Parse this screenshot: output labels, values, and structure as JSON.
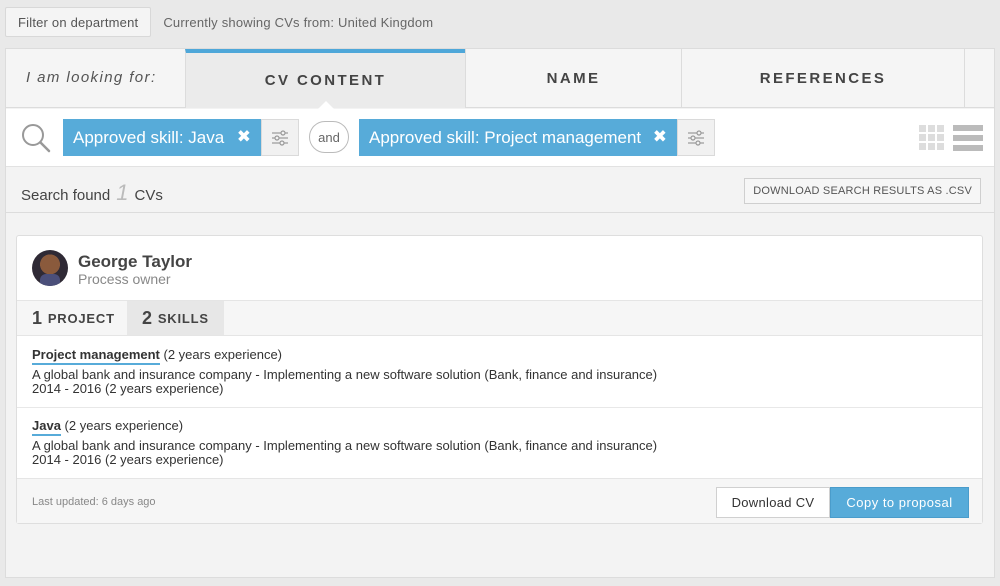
{
  "topbar": {
    "filter_label": "Filter on department",
    "showing_text": "Currently showing CVs from: United Kingdom"
  },
  "tabs": {
    "looking_label": "I am looking for:",
    "items": [
      {
        "label": "CV CONTENT",
        "active": true
      },
      {
        "label": "NAME",
        "active": false
      },
      {
        "label": "REFERENCES",
        "active": false
      }
    ]
  },
  "search": {
    "chips": [
      {
        "label": "Approved skill: Java",
        "remove": "✖"
      },
      {
        "label": "Approved skill: Project management",
        "remove": "✖"
      }
    ],
    "operator": "and"
  },
  "results": {
    "prefix": "Search found",
    "count": "1",
    "suffix": "CVs",
    "download_csv_label": "DOWNLOAD SEARCH RESULTS AS .CSV"
  },
  "cv": {
    "name": "George Taylor",
    "role": "Process owner",
    "tabs": [
      {
        "count": "1",
        "label": "PROJECT"
      },
      {
        "count": "2",
        "label": "SKILLS"
      }
    ],
    "skills": [
      {
        "skill": "Project management",
        "experience": "(2 years experience)",
        "detail": "A global bank and insurance company - Implementing a new software solution (Bank, finance and insurance)",
        "period": "2014 - 2016 (2 years experience)"
      },
      {
        "skill": "Java",
        "experience": "(2 years experience)",
        "detail": "A global bank and insurance company - Implementing a new software solution (Bank, finance and insurance)",
        "period": "2014 - 2016 (2 years experience)"
      }
    ],
    "last_updated": "Last updated: 6 days ago",
    "download_label": "Download CV",
    "copy_label": "Copy to proposal"
  },
  "colors": {
    "accent": "#57abd9",
    "background": "#e9e9e9"
  },
  "icons": [
    "search-icon",
    "close-icon",
    "settings-sliders-icon",
    "grid-view-icon",
    "list-view-icon"
  ]
}
